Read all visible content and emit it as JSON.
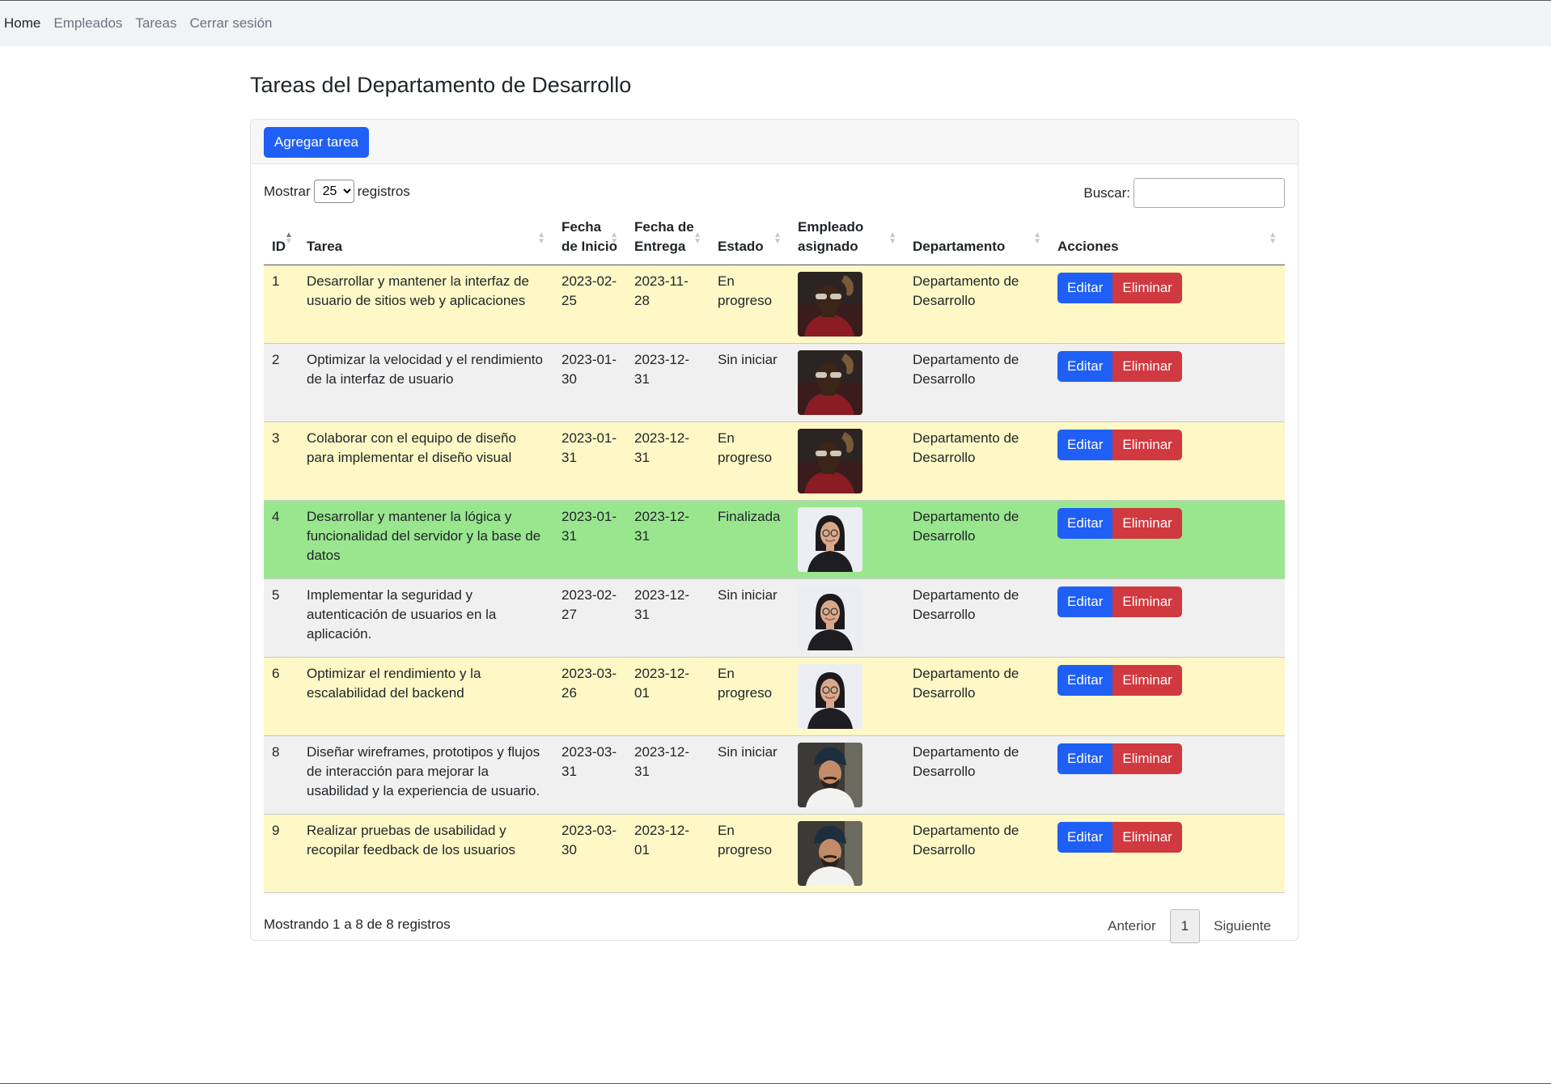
{
  "nav": {
    "items": [
      {
        "label": "Home",
        "active": true
      },
      {
        "label": "Empleados",
        "active": false
      },
      {
        "label": "Tareas",
        "active": false
      },
      {
        "label": "Cerrar sesión",
        "active": false
      }
    ]
  },
  "page": {
    "title": "Tareas del Departamento de Desarrollo"
  },
  "toolbar": {
    "add_label": "Agregar tarea"
  },
  "length": {
    "prefix": "Mostrar",
    "value": "25",
    "suffix": "registros"
  },
  "search": {
    "label": "Buscar:",
    "value": ""
  },
  "table": {
    "columns": [
      "ID",
      "Tarea",
      "Fecha de Inicio",
      "Fecha de Entrega",
      "Estado",
      "Empleado asignado",
      "Departamento",
      "Acciones"
    ],
    "rows": [
      {
        "id": "1",
        "task": "Desarrollar y mantener la interfaz de usuario de sitios web y aplicaciones",
        "start": "2023-02-25",
        "due": "2023-11-28",
        "status": "En progreso",
        "employee_avatar": "man-sunglasses-avatar",
        "department": "Departamento de Desarrollo",
        "edit": "Editar",
        "delete": "Eliminar",
        "row_color": "#fef8c6"
      },
      {
        "id": "2",
        "task": "Optimizar la velocidad y el rendimiento de la interfaz de usuario",
        "start": "2023-01-30",
        "due": "2023-12-31",
        "status": "Sin iniciar",
        "employee_avatar": "man-sunglasses-avatar",
        "department": "Departamento de Desarrollo",
        "edit": "Editar",
        "delete": "Eliminar",
        "row_color": "#f0f0f0"
      },
      {
        "id": "3",
        "task": "Colaborar con el equipo de diseño para implementar el diseño visual",
        "start": "2023-01-31",
        "due": "2023-12-31",
        "status": "En progreso",
        "employee_avatar": "man-sunglasses-avatar",
        "department": "Departamento de Desarrollo",
        "edit": "Editar",
        "delete": "Eliminar",
        "row_color": "#fef8c6"
      },
      {
        "id": "4",
        "task": "Desarrollar y mantener la lógica y funcionalidad del servidor y la base de datos",
        "start": "2023-01-31",
        "due": "2023-12-31",
        "status": "Finalizada",
        "employee_avatar": "woman-glasses-avatar",
        "department": "Departamento de Desarrollo",
        "edit": "Editar",
        "delete": "Eliminar",
        "row_color": "#99e68f"
      },
      {
        "id": "5",
        "task": "Implementar la seguridad y autenticación de usuarios en la aplicación.",
        "start": "2023-02-27",
        "due": "2023-12-31",
        "status": "Sin iniciar",
        "employee_avatar": "woman-glasses-avatar",
        "department": "Departamento de Desarrollo",
        "edit": "Editar",
        "delete": "Eliminar",
        "row_color": "#f0f0f0"
      },
      {
        "id": "6",
        "task": "Optimizar el rendimiento y la escalabilidad del backend",
        "start": "2023-03-26",
        "due": "2023-12-01",
        "status": "En progreso",
        "employee_avatar": "woman-glasses-avatar",
        "department": "Departamento de Desarrollo",
        "edit": "Editar",
        "delete": "Eliminar",
        "row_color": "#fef8c6"
      },
      {
        "id": "8",
        "task": "Diseñar wireframes, prototipos y flujos de interacción para mejorar la usabilidad y la experiencia de usuario.",
        "start": "2023-03-31",
        "due": "2023-12-31",
        "status": "Sin iniciar",
        "employee_avatar": "man-turban-avatar",
        "department": "Departamento de Desarrollo",
        "edit": "Editar",
        "delete": "Eliminar",
        "row_color": "#f0f0f0"
      },
      {
        "id": "9",
        "task": "Realizar pruebas de usabilidad y recopilar feedback de los usuarios",
        "start": "2023-03-30",
        "due": "2023-12-01",
        "status": "En progreso",
        "employee_avatar": "man-turban-avatar",
        "department": "Departamento de Desarrollo",
        "edit": "Editar",
        "delete": "Eliminar",
        "row_color": "#fef8c6"
      }
    ]
  },
  "footer": {
    "info": "Mostrando 1 a 8 de 8 registros",
    "prev": "Anterior",
    "current_page": "1",
    "next": "Siguiente"
  }
}
